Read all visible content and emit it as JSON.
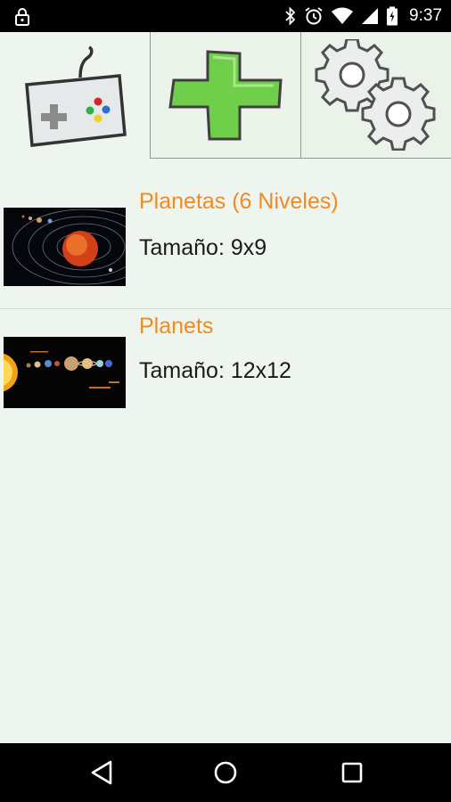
{
  "status_bar": {
    "time": "9:37",
    "icons": [
      "lock-icon",
      "bluetooth-icon",
      "alarm-icon",
      "wifi-icon",
      "signal-icon",
      "battery-icon"
    ]
  },
  "tabs": [
    {
      "name": "gamepad-icon",
      "active": true
    },
    {
      "name": "plus-icon",
      "active": false
    },
    {
      "name": "gears-icon",
      "active": false
    }
  ],
  "puzzles": [
    {
      "title": "Planetas (6 Niveles)",
      "size": "Tamaño: 9x9",
      "thumb": "solar-system-orbits-image"
    },
    {
      "title": "Planets",
      "size": "Tamaño: 12x12",
      "thumb": "planets-lineup-image"
    }
  ],
  "nav_bar": {
    "buttons": [
      "back-icon",
      "home-icon",
      "recents-icon"
    ]
  },
  "colors": {
    "accent": "#f08a24",
    "background": "#eef5ee",
    "text": "#1a1a1a"
  }
}
